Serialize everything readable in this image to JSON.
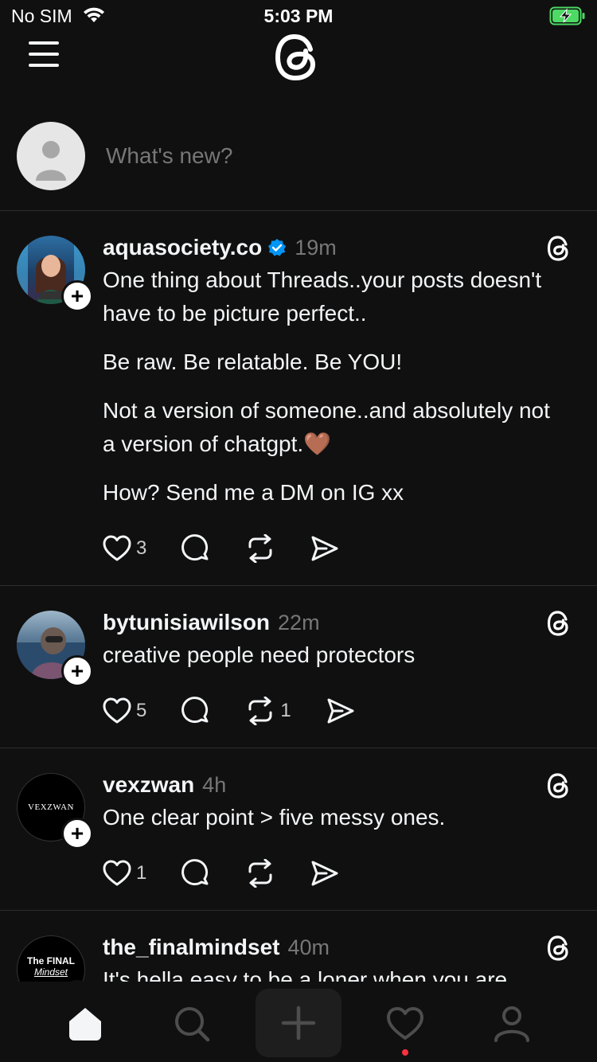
{
  "status_bar": {
    "carrier": "No SIM",
    "time": "5:03 PM"
  },
  "composer": {
    "placeholder": "What's new?"
  },
  "posts": [
    {
      "username": "aquasociety.co",
      "verified": true,
      "time": "19m",
      "paragraphs": [
        "One thing about Threads..your posts doesn't have to be picture perfect..",
        "Be raw. Be relatable. Be YOU!",
        "Not a version of someone..and absolutely not a version of chatgpt.🤎",
        "How? Send me a DM on IG xx"
      ],
      "likes": "3",
      "replies": "",
      "reposts": ""
    },
    {
      "username": "bytunisiawilson",
      "verified": false,
      "time": "22m",
      "paragraphs": [
        "creative people need protectors"
      ],
      "likes": "5",
      "replies": "",
      "reposts": "1"
    },
    {
      "username": "vexzwan",
      "verified": false,
      "time": "4h",
      "avatar_text": "VEXZWAN",
      "paragraphs": [
        "One clear point > five messy ones."
      ],
      "likes": "1",
      "replies": "",
      "reposts": ""
    },
    {
      "username": "the_finalmindset",
      "verified": false,
      "time": "40m",
      "avatar_text_1": "The FINAL",
      "avatar_text_2": "Mindset",
      "paragraphs": [
        "It's hella easy to be a loner when you are"
      ],
      "likes": "",
      "replies": "",
      "reposts": ""
    }
  ],
  "tabbar": {
    "items": [
      "home-icon",
      "search-icon",
      "plus-icon",
      "heart-icon",
      "profile-icon"
    ],
    "active": "home",
    "notification_dot_color": "#ff3040"
  },
  "colors": {
    "background": "#101010",
    "verified": "#0095f6",
    "muted": "#777777"
  }
}
